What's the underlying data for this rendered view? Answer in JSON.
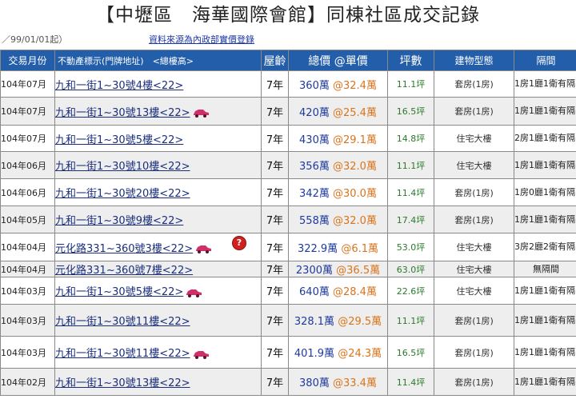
{
  "page": {
    "title": "【中壢區　海華國際會館】同棟社區成交記錄",
    "since": "／99/01/01起）",
    "source": "資料來源為內政部實價登錄"
  },
  "columns": {
    "date": "交易月份",
    "address": "不動產標示(門牌地址)　<總樓高>",
    "age": "屋齡",
    "price": "總價 @單價",
    "ping": "坪數",
    "type": "建物型態",
    "rooms": "隔間"
  },
  "rows": [
    {
      "date": "104年07月",
      "address": "九和一街1~30號4樓<22>",
      "car": false,
      "question": false,
      "age": "7年",
      "total": "360萬",
      "unit": "@32.4萬",
      "ping": "11.1坪",
      "type": "套房(1房)",
      "rooms": "1房1廳1衛有隔間"
    },
    {
      "date": "104年07月",
      "address": "九和一街1~30號13樓<22>",
      "car": true,
      "question": false,
      "age": "7年",
      "total": "420萬",
      "unit": "@25.4萬",
      "ping": "16.5坪",
      "type": "套房(1房)",
      "rooms": "1房1廳1衛有隔間"
    },
    {
      "date": "104年07月",
      "address": "九和一街1~30號5樓<22>",
      "car": false,
      "question": false,
      "age": "7年",
      "total": "430萬",
      "unit": "@29.1萬",
      "ping": "14.8坪",
      "type": "住宅大樓",
      "rooms": "2房1廳1衛有隔間"
    },
    {
      "date": "104年06月",
      "address": "九和一街1~30號10樓<22>",
      "car": false,
      "question": false,
      "age": "7年",
      "total": "356萬",
      "unit": "@32.0萬",
      "ping": "11.1坪",
      "type": "住宅大樓",
      "rooms": "1房1廳1衛有隔間"
    },
    {
      "date": "104年06月",
      "address": "九和一街1~30號20樓<22>",
      "car": false,
      "question": false,
      "age": "7年",
      "total": "342萬",
      "unit": "@30.0萬",
      "ping": "11.4坪",
      "type": "套房(1房)",
      "rooms": "1房0廳1衛有隔間"
    },
    {
      "date": "104年05月",
      "address": "九和一街1~30號9樓<22>",
      "car": false,
      "question": false,
      "age": "7年",
      "total": "558萬",
      "unit": "@32.0萬",
      "ping": "17.4坪",
      "type": "套房(1房)",
      "rooms": "1房1廳1衛有隔間"
    },
    {
      "date": "104年04月",
      "address": "元化路331~360號3樓<22>",
      "car": true,
      "question": true,
      "age": "7年",
      "total": "322.9萬",
      "unit": "@6.1萬",
      "ping": "53.0坪",
      "type": "住宅大樓",
      "rooms": "3房2廳2衛有隔間"
    },
    {
      "date": "104年04月",
      "address": "元化路331~360號7樓<22>",
      "car": false,
      "question": false,
      "age": "7年",
      "total": "2300萬",
      "unit": "@36.5萬",
      "ping": "63.0坪",
      "type": "住宅大樓",
      "rooms": "無隔間"
    },
    {
      "date": "104年03月",
      "address": "九和一街1~30號5樓<22>",
      "car": true,
      "question": false,
      "age": "7年",
      "total": "640萬",
      "unit": "@28.4萬",
      "ping": "22.6坪",
      "type": "住宅大樓",
      "rooms": "1房1廳1衛有隔間"
    },
    {
      "date": "104年03月",
      "address": "九和一街1~30號11樓<22>",
      "car": false,
      "question": false,
      "age": "7年",
      "total": "328.1萬",
      "unit": "@29.5萬",
      "ping": "11.1坪",
      "type": "套房(1房)",
      "rooms": "1房1廳1衛有隔間"
    },
    {
      "date": "104年03月",
      "address": "九和一街1~30號11樓<22>",
      "car": true,
      "question": false,
      "age": "7年",
      "total": "401.9萬",
      "unit": "@24.3萬",
      "ping": "16.5坪",
      "type": "套房(1房)",
      "rooms": "1房1廳1衛有隔間"
    },
    {
      "date": "104年02月",
      "address": "九和一街1~30號13樓<22>",
      "car": false,
      "question": false,
      "age": "7年",
      "total": "380萬",
      "unit": "@33.4萬",
      "ping": "11.4坪",
      "type": "套房(1房)",
      "rooms": "1房1廳1衛有隔間"
    }
  ],
  "colors": {
    "header_bg": "#235eaa",
    "total": "#1e3a9e",
    "unit": "#d9741c",
    "ping": "#2a7a2a",
    "car": "#d0306a",
    "question": "#d12020"
  },
  "icons": {
    "car": "car-icon",
    "question": "question-icon"
  },
  "question_text": "?"
}
